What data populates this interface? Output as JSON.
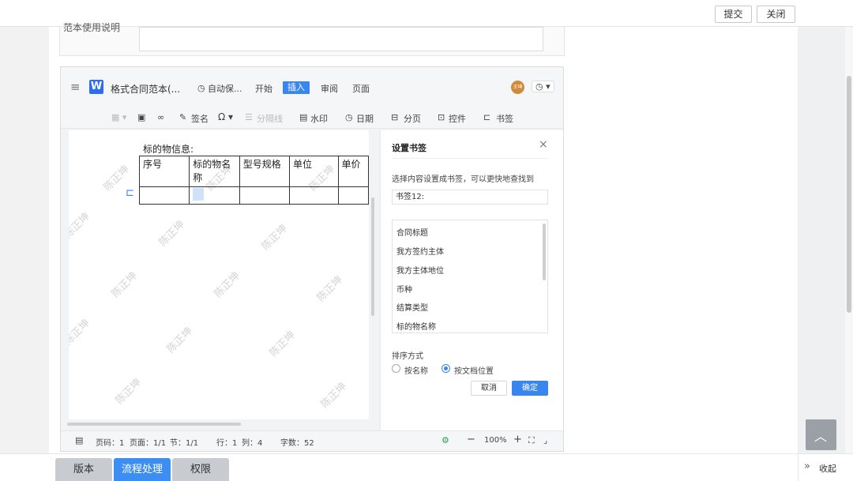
{
  "header": {
    "submit_label": "提交",
    "close_label": "关闭"
  },
  "form": {
    "note_label": "范本使用说明"
  },
  "editor": {
    "doc_title": "格式合同范本(...",
    "autosave": "自动保...",
    "menu_tabs": [
      "开始",
      "插入",
      "审阅",
      "页面"
    ],
    "active_tab": "插入",
    "avatar_text": "王坤",
    "toolbar": {
      "signature": "签名",
      "separator": "分隔线",
      "watermark": "水印",
      "date": "日期",
      "pagebreak": "分页",
      "control": "控件",
      "bookmark": "书签"
    },
    "doc": {
      "section_label": "标的物信息:",
      "table_headers": [
        "序号",
        "标的物名称",
        "型号规格",
        "单位",
        "单价"
      ],
      "watermark_text": "陈正坤"
    },
    "status": {
      "page_code": "页码：1",
      "pages": "页面：1/1",
      "section": "节：1/1",
      "row": "行：1",
      "col": "列：4",
      "words": "字数：52",
      "zoom": "100%"
    }
  },
  "bookmark_panel": {
    "title": "设置书签",
    "hint": "选择内容设置成书签，可以更快地查找到",
    "input_value": "书签12:",
    "items": [
      "合同标题",
      "我方签约主体",
      "我方主体地位",
      "币种",
      "结算类型",
      "标的物名称"
    ],
    "sort_label": "排序方式",
    "sort_by_name": "按名称",
    "sort_by_position": "按文档位置",
    "sort_selected": "按文档位置",
    "cancel_label": "取消",
    "ok_label": "确定"
  },
  "bottom_tabs": [
    "版本",
    "流程处理",
    "权限"
  ],
  "active_bottom_tab": "流程处理",
  "collapse_label": "收起",
  "colors": {
    "accent": "#3a86f0",
    "active_tab_bg": "#3d8ef2",
    "tab_bg": "#c8cbd0"
  }
}
